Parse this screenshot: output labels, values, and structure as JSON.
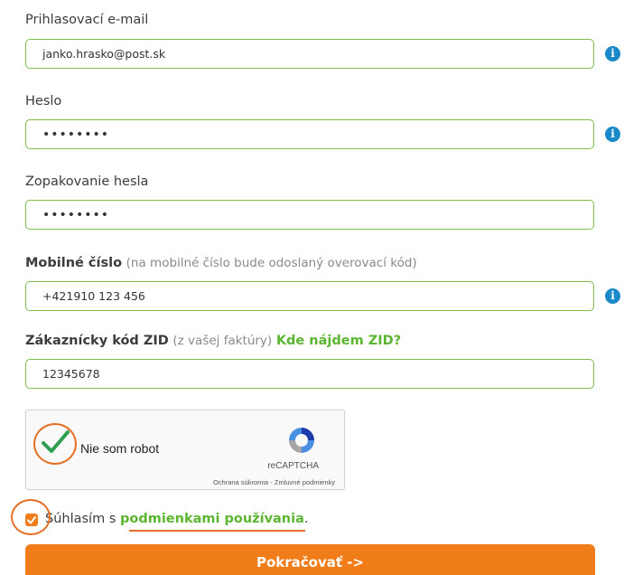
{
  "email": {
    "label": "Prihlasovací e-mail",
    "value": "janko.hrasko@post.sk"
  },
  "password": {
    "label": "Heslo",
    "value": "••••••••"
  },
  "password_repeat": {
    "label": "Zopakovanie hesla",
    "value": "••••••••"
  },
  "mobile": {
    "label": "Mobilné číslo",
    "hint": "(na mobilné číslo bude odoslaný overovací kód)",
    "value": "+421910 123 456"
  },
  "zid": {
    "label": "Zákaznícky kód ZID",
    "hint": "(z vašej faktúry)",
    "help_link": "Kde nájdem ZID?",
    "value": "12345678"
  },
  "recaptcha": {
    "label": "Nie som robot",
    "brand": "reCAPTCHA",
    "terms": "Ochrana súkromia - Zmluvné podmienky",
    "checked": true
  },
  "consent": {
    "prefix": "Súhlasím s ",
    "link": "podmienkami používania",
    "suffix": ".",
    "checked": true
  },
  "submit": {
    "label": "Pokračovať ->"
  },
  "icons": {
    "info": "info-icon",
    "check": "check-icon",
    "recaptcha_logo": "recaptcha-logo-icon"
  },
  "colors": {
    "accent_green": "#5cb531",
    "field_border": "#7cc04a",
    "orange": "#f07d1a",
    "info_blue": "#1a88c9"
  }
}
